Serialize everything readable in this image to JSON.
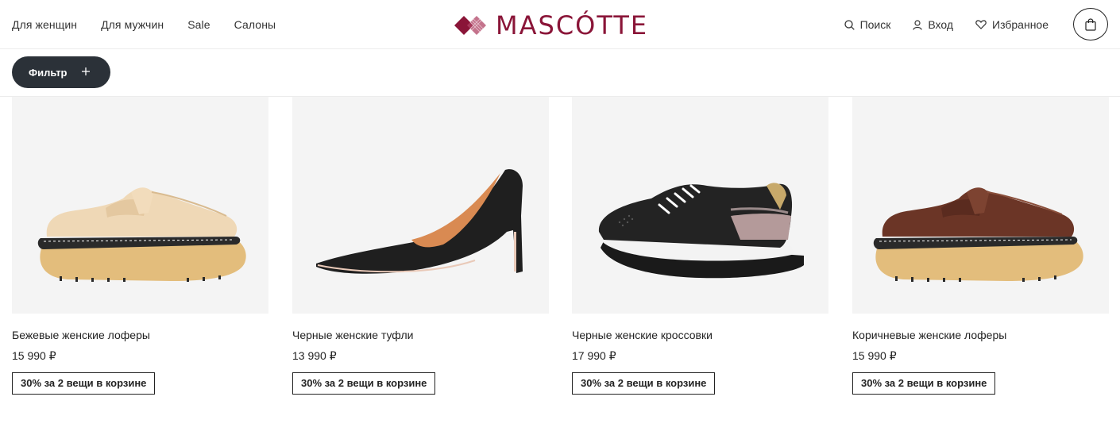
{
  "header": {
    "nav_left": [
      "Для женщин",
      "Для мужчин",
      "Sale",
      "Салоны"
    ],
    "logo_text": "MASCÓTTE",
    "brand_color": "#8a1538",
    "search_label": "Поиск",
    "login_label": "Вход",
    "favorites_label": "Избранное"
  },
  "filter": {
    "label": "Фильтр"
  },
  "products": [
    {
      "name": "Бежевые женские лоферы",
      "price": "15 990 ₽",
      "promo": "30% за 2 вещи в корзине",
      "image": "beige-loafer"
    },
    {
      "name": "Черные женские туфли",
      "price": "13 990 ₽",
      "promo": "30% за 2 вещи в корзине",
      "image": "black-pump"
    },
    {
      "name": "Черные женские кроссовки",
      "price": "17 990 ₽",
      "promo": "30% за 2 вещи в корзине",
      "image": "black-sneaker"
    },
    {
      "name": "Коричневые женские лоферы",
      "price": "15 990 ₽",
      "promo": "30% за 2 вещи в корзине",
      "image": "brown-loafer"
    }
  ]
}
